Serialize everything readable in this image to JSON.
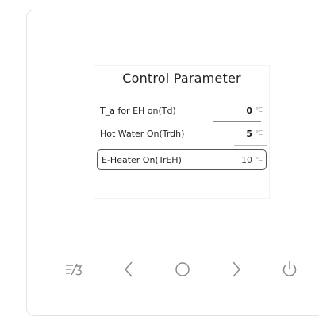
{
  "screen": {
    "title": "Control Parameter",
    "rows": [
      {
        "label": "T_a for EH on(Td)",
        "value": "0",
        "unit": "℃",
        "selected": false
      },
      {
        "label": "Hot Water On(Trdh)",
        "value": "5",
        "unit": "℃",
        "selected": false
      },
      {
        "label": "E-Heater On(TrEH)",
        "value": "10",
        "unit": "℃",
        "selected": true
      }
    ]
  },
  "buttons": {
    "menu_icon": "menu-mode-icon",
    "left_icon": "chevron-left-icon",
    "ok_icon": "circle-ok-icon",
    "right_icon": "chevron-right-icon",
    "power_icon": "power-icon"
  },
  "colors": {
    "panel_border": "#e3e3e3",
    "icon_stroke": "#8a8a8a",
    "selected_border": "#555555"
  }
}
